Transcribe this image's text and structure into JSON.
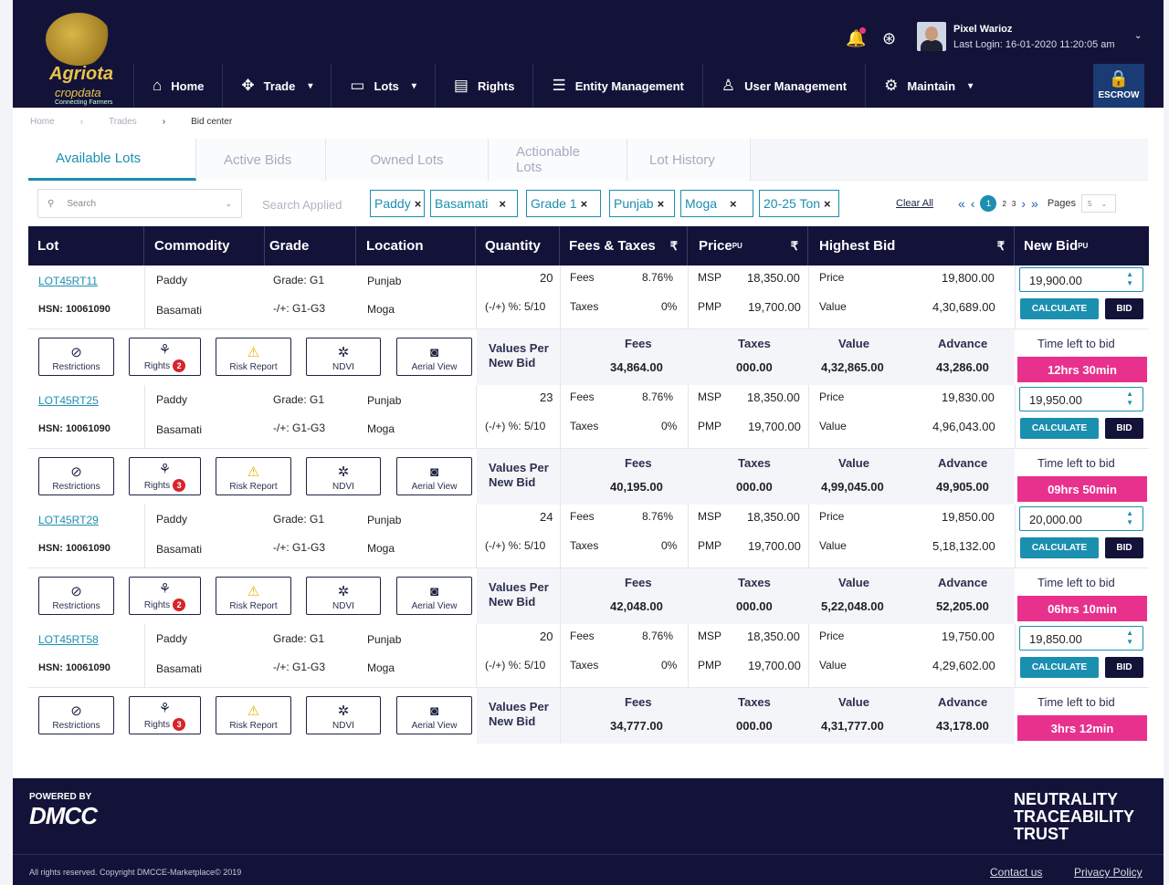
{
  "brand": {
    "name": "Agriota",
    "sub": "cropdata",
    "tagline": "Connecting Farmers"
  },
  "user": {
    "name": "Pixel Warioz",
    "last_login": "Last Login: 16-01-2020  11:20:05 am"
  },
  "nav": [
    {
      "label": "Home",
      "icon": "home-icon"
    },
    {
      "label": "Trade",
      "icon": "handshake-icon",
      "caret": "▾"
    },
    {
      "label": "Lots",
      "icon": "folder-icon",
      "caret": "▾"
    },
    {
      "label": "Rights",
      "icon": "document-icon"
    },
    {
      "label": "Entity Management",
      "icon": "list-icon"
    },
    {
      "label": "User Management",
      "icon": "user-icon"
    },
    {
      "label": "Maintain",
      "icon": "settings-icon",
      "caret": "▾"
    }
  ],
  "escrow": {
    "label": "ESCROW"
  },
  "breadcrumb": [
    "Home",
    "Trades",
    "Bid center"
  ],
  "tabs": [
    "Available Lots",
    "Active Bids",
    "Owned Lots",
    "Actionable Lots",
    "Lot History"
  ],
  "filters": {
    "search_placeholder": "Search",
    "applied_label": "Search Applied",
    "chips": [
      "Paddy",
      "Basamati",
      "Grade 1",
      "Punjab",
      "Moga",
      "20-25 Ton"
    ],
    "clear_all": "Clear All",
    "pages_label": "Pages",
    "pages_value": "5",
    "page_numbers": [
      "1",
      "2",
      "3"
    ]
  },
  "columns": {
    "lot": "Lot",
    "commodity": "Commodity",
    "grade": "Grade",
    "location": "Location",
    "quantity": "Quantity",
    "fees_taxes": "Fees & Taxes",
    "price": "Price",
    "highest_bid": "Highest Bid",
    "new_bid": "New Bid",
    "pu": "PU",
    "rupee": "₹"
  },
  "labels": {
    "fees": "Fees",
    "taxes": "Taxes",
    "msp": "MSP",
    "pmp": "PMP",
    "price": "Price",
    "value": "Value",
    "values_per_new_bid": "Values Per New Bid",
    "advance": "Advance",
    "time_left": "Time left to bid",
    "calculate": "CALCULATE",
    "bid": "BID",
    "restrictions": "Restrictions",
    "rights": "Rights",
    "risk_report": "Risk Report",
    "ndvi": "NDVI",
    "aerial_view": "Aerial View"
  },
  "lots": [
    {
      "id": "LOT45RT11",
      "hsn": "HSN: 10061090",
      "commodity": "Paddy",
      "variety": "Basamati",
      "grade": "Grade: G1",
      "grade_range": "-/+: G1-G3",
      "state": "Punjab",
      "district": "Moga",
      "quantity": "20",
      "tolerance": "(-/+) %: 5/10",
      "fees_pct": "8.76%",
      "taxes_pct": "0%",
      "msp": "18,350.00",
      "pmp": "19,700.00",
      "hb_price": "19,800.00",
      "hb_value": "4,30,689.00",
      "new_bid": "19,900.00",
      "rights_count": "2",
      "nb_fees": "34,864.00",
      "nb_taxes": "000.00",
      "nb_value": "4,32,865.00",
      "nb_advance": "43,286.00",
      "time_left": "12hrs 30min"
    },
    {
      "id": "LOT45RT25",
      "hsn": "HSN: 10061090",
      "commodity": "Paddy",
      "variety": "Basamati",
      "grade": "Grade: G1",
      "grade_range": "-/+: G1-G3",
      "state": "Punjab",
      "district": "Moga",
      "quantity": "23",
      "tolerance": "(-/+) %: 5/10",
      "fees_pct": "8.76%",
      "taxes_pct": "0%",
      "msp": "18,350.00",
      "pmp": "19,700.00",
      "hb_price": "19,830.00",
      "hb_value": "4,96,043.00",
      "new_bid": "19,950.00",
      "rights_count": "3",
      "nb_fees": "40,195.00",
      "nb_taxes": "000.00",
      "nb_value": "4,99,045.00",
      "nb_advance": "49,905.00",
      "time_left": "09hrs 50min"
    },
    {
      "id": "LOT45RT29",
      "hsn": "HSN: 10061090",
      "commodity": "Paddy",
      "variety": "Basamati",
      "grade": "Grade: G1",
      "grade_range": "-/+: G1-G3",
      "state": "Punjab",
      "district": "Moga",
      "quantity": "24",
      "tolerance": "(-/+) %: 5/10",
      "fees_pct": "8.76%",
      "taxes_pct": "0%",
      "msp": "18,350.00",
      "pmp": "19,700.00",
      "hb_price": "19,850.00",
      "hb_value": "5,18,132.00",
      "new_bid": "20,000.00",
      "rights_count": "2",
      "nb_fees": "42,048.00",
      "nb_taxes": "000.00",
      "nb_value": "5,22,048.00",
      "nb_advance": "52,205.00",
      "time_left": "06hrs 10min"
    },
    {
      "id": "LOT45RT58",
      "hsn": "HSN: 10061090",
      "commodity": "Paddy",
      "variety": "Basamati",
      "grade": "Grade: G1",
      "grade_range": "-/+: G1-G3",
      "state": "Punjab",
      "district": "Moga",
      "quantity": "20",
      "tolerance": "(-/+) %: 5/10",
      "fees_pct": "8.76%",
      "taxes_pct": "0%",
      "msp": "18,350.00",
      "pmp": "19,700.00",
      "hb_price": "19,750.00",
      "hb_value": "4,29,602.00",
      "new_bid": "19,850.00",
      "rights_count": "3",
      "nb_fees": "34,777.00",
      "nb_taxes": "000.00",
      "nb_value": "4,31,777.00",
      "nb_advance": "43,178.00",
      "time_left": "3hrs 12min"
    }
  ],
  "footer": {
    "powered_by": "POWERED BY",
    "dmcc": "DMCC",
    "motto": [
      "NEUTRALITY",
      "TRACEABILITY",
      "TRUST"
    ],
    "copyright": "All rights reserved. Copyright DMCCE-Marketplace© 2019",
    "contact": "Contact us",
    "privacy": "Privacy Policy"
  },
  "colors": {
    "navy": "#13133a",
    "accent": "#1b8fb0",
    "timer": "#e8308d",
    "badge": "#d8242b"
  }
}
